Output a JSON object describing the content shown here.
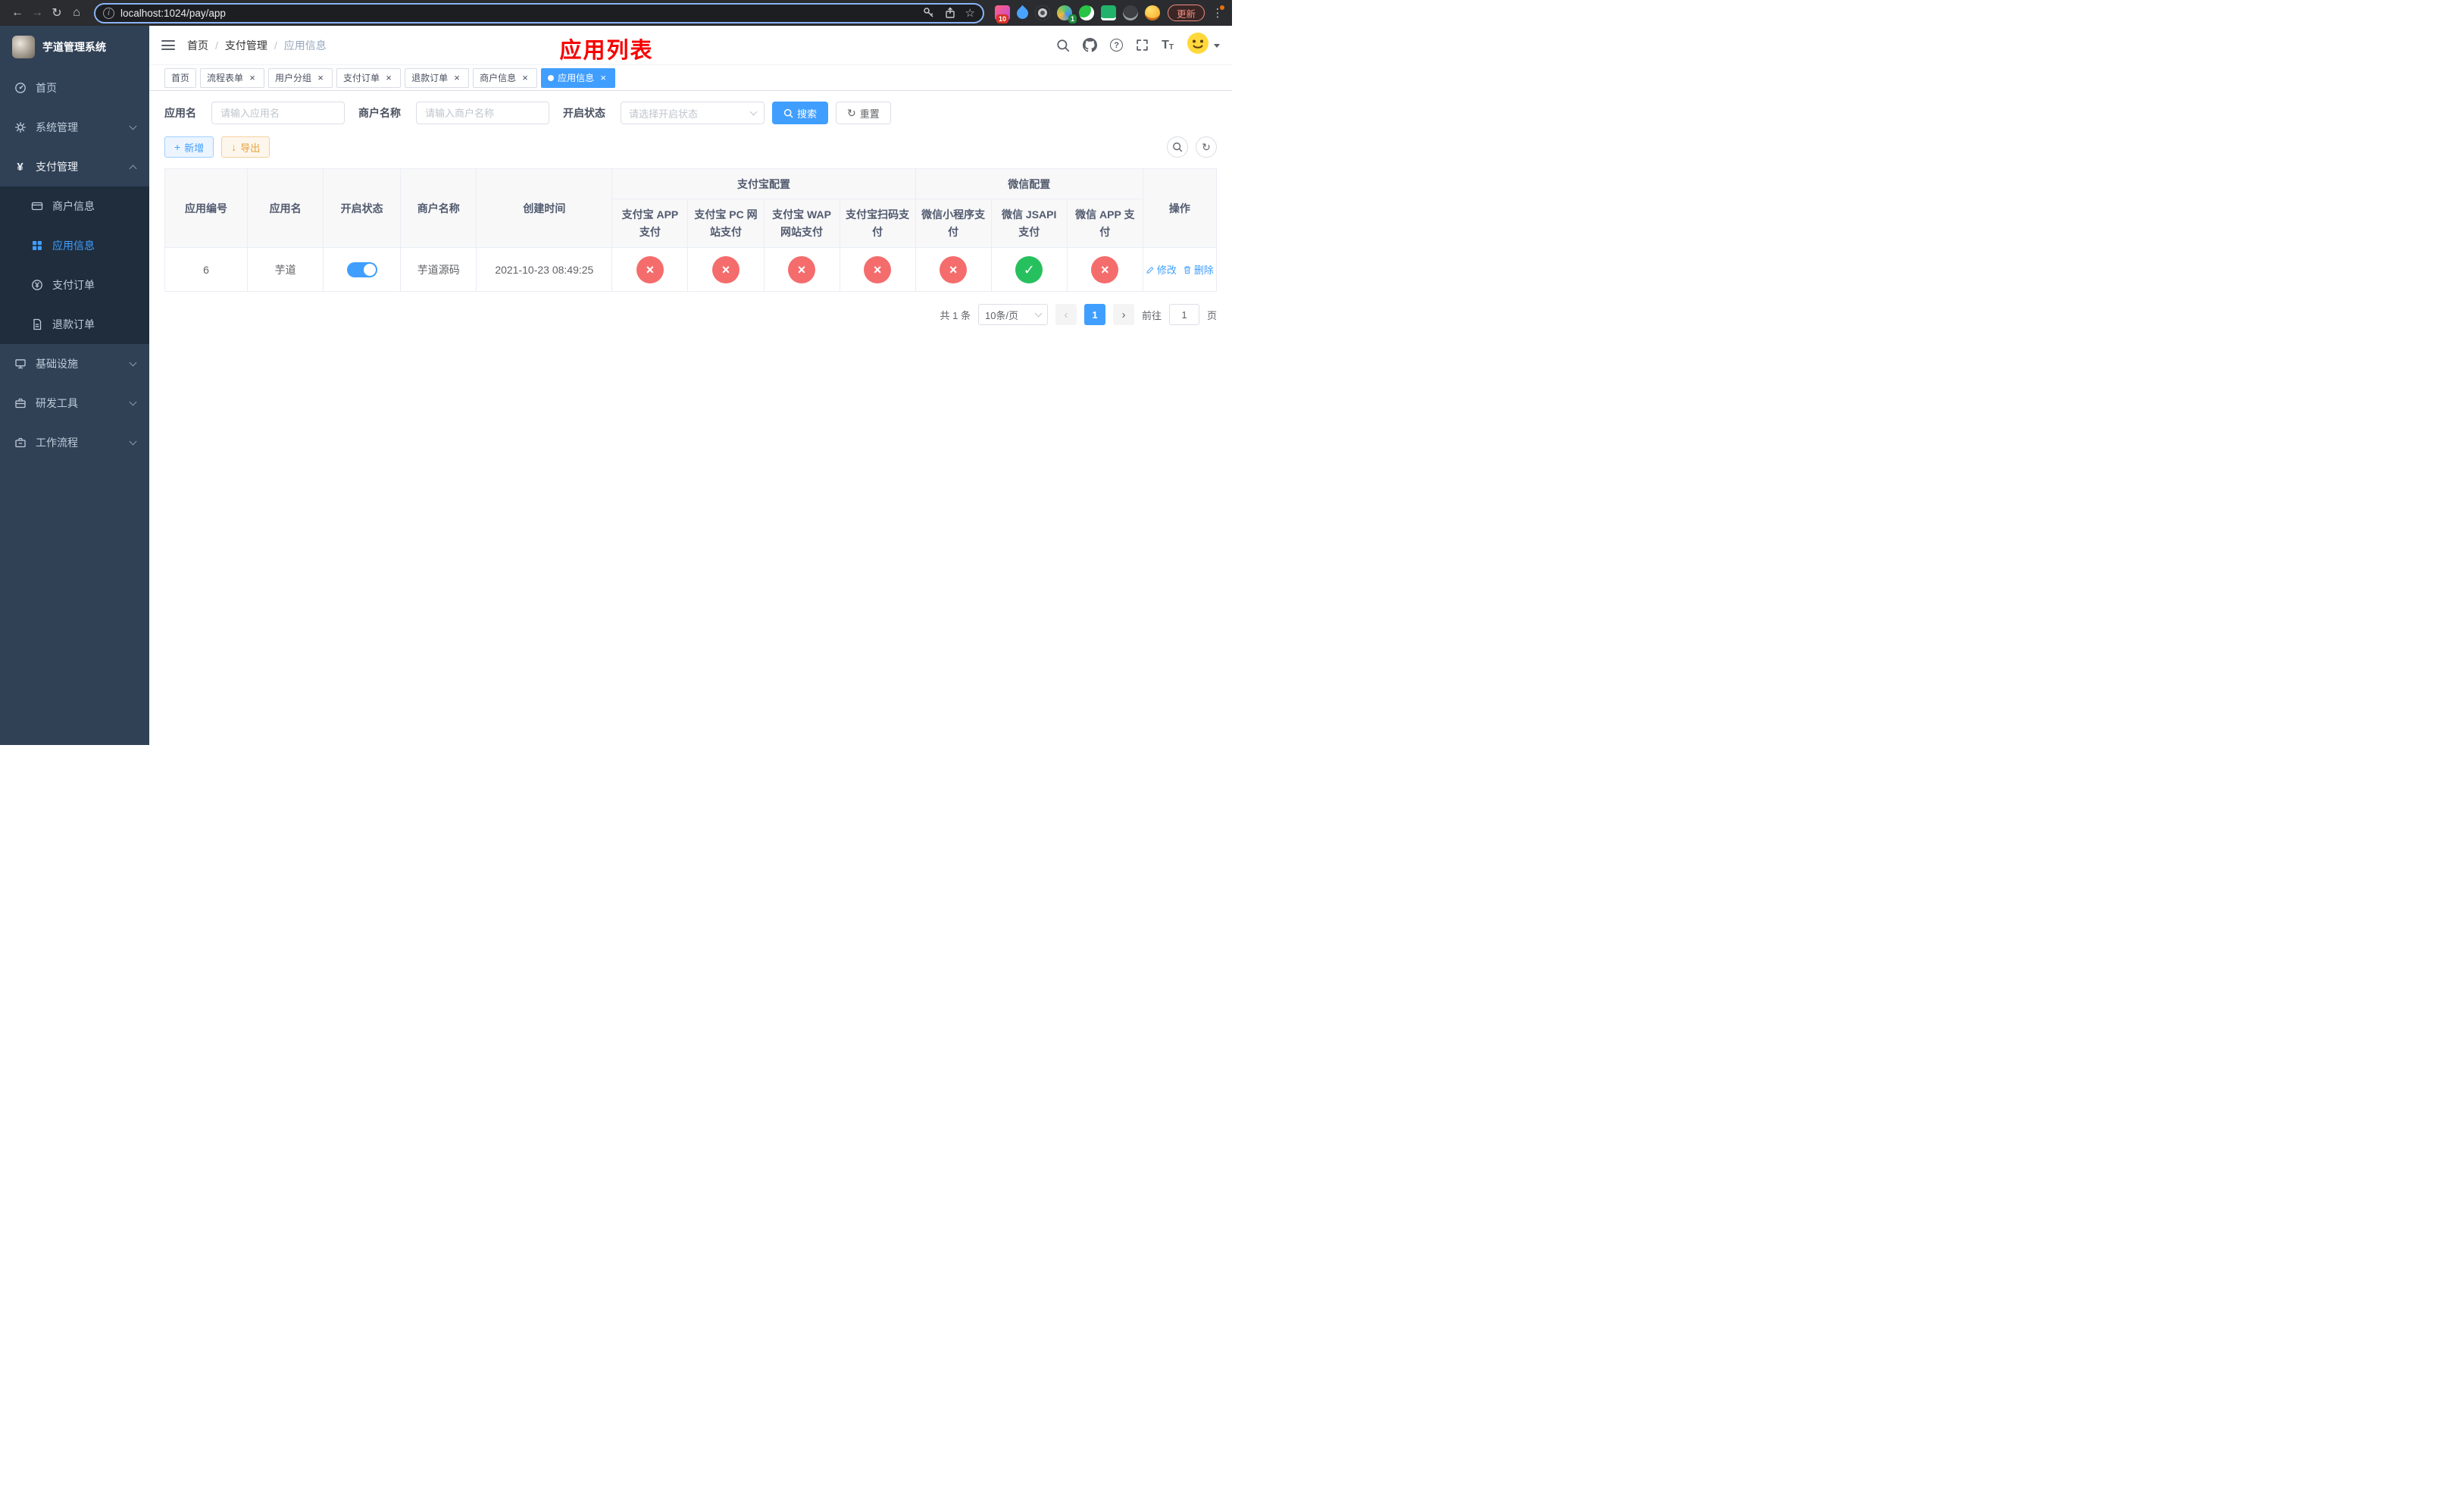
{
  "browser": {
    "url": "localhost:1024/pay/app",
    "update_label": "更新",
    "extension_badge_red": "10",
    "extension_badge_green": "1"
  },
  "icons": {
    "back": "←",
    "forward": "→",
    "reload": "↻",
    "home": "⌂",
    "info": "i",
    "star": "☆",
    "kebab": "⋮",
    "help": "?",
    "font_large": "T",
    "font_small": "T",
    "yen": "¥",
    "plus": "+",
    "download": "↓",
    "refresh": "↻",
    "prev": "‹",
    "next": "›",
    "check": "✓",
    "cross": "×"
  },
  "sidebar": {
    "title": "芋道管理系统",
    "items": [
      {
        "label": "首页"
      },
      {
        "label": "系统管理"
      },
      {
        "label": "支付管理",
        "children": [
          {
            "label": "商户信息"
          },
          {
            "label": "应用信息"
          },
          {
            "label": "支付订单"
          },
          {
            "label": "退款订单"
          }
        ]
      },
      {
        "label": "基础设施"
      },
      {
        "label": "研发工具"
      },
      {
        "label": "工作流程"
      }
    ]
  },
  "header": {
    "breadcrumb": [
      "首页",
      "支付管理",
      "应用信息"
    ],
    "title": "应用列表"
  },
  "tabs": [
    {
      "label": "首页"
    },
    {
      "label": "流程表单"
    },
    {
      "label": "用户分组"
    },
    {
      "label": "支付订单"
    },
    {
      "label": "退款订单"
    },
    {
      "label": "商户信息"
    },
    {
      "label": "应用信息"
    }
  ],
  "filters": {
    "app_name": {
      "label": "应用名",
      "placeholder": "请输入应用名"
    },
    "merchant_name": {
      "label": "商户名称",
      "placeholder": "请输入商户名称"
    },
    "status": {
      "label": "开启状态",
      "placeholder": "请选择开启状态"
    },
    "search": "搜索",
    "reset": "重置"
  },
  "toolbar": {
    "add": "新增",
    "export": "导出"
  },
  "table": {
    "columns": [
      "应用编号",
      "应用名",
      "开启状态",
      "商户名称",
      "创建时间"
    ],
    "group_alipay": {
      "label": "支付宝配置",
      "children": [
        "支付宝 APP 支付",
        "支付宝 PC 网站支付",
        "支付宝 WAP 网站支付",
        "支付宝扫码支付"
      ]
    },
    "group_wechat": {
      "label": "微信配置",
      "children": [
        "微信小程序支付",
        "微信 JSAPI 支付",
        "微信 APP 支付"
      ]
    },
    "actions_column": "操作",
    "rows": [
      {
        "id": "6",
        "name": "芋道",
        "enabled": true,
        "merchant": "芋道源码",
        "created_at": "2021-10-23 08:49:25",
        "statuses": [
          "off",
          "off",
          "off",
          "off",
          "off",
          "on",
          "off"
        ],
        "edit": "修改",
        "delete": "删除"
      }
    ]
  },
  "pagination": {
    "total": "共 1 条",
    "page_size": "10条/页",
    "current": "1",
    "goto_label": "前往",
    "goto_value": "1",
    "unit": "页"
  }
}
